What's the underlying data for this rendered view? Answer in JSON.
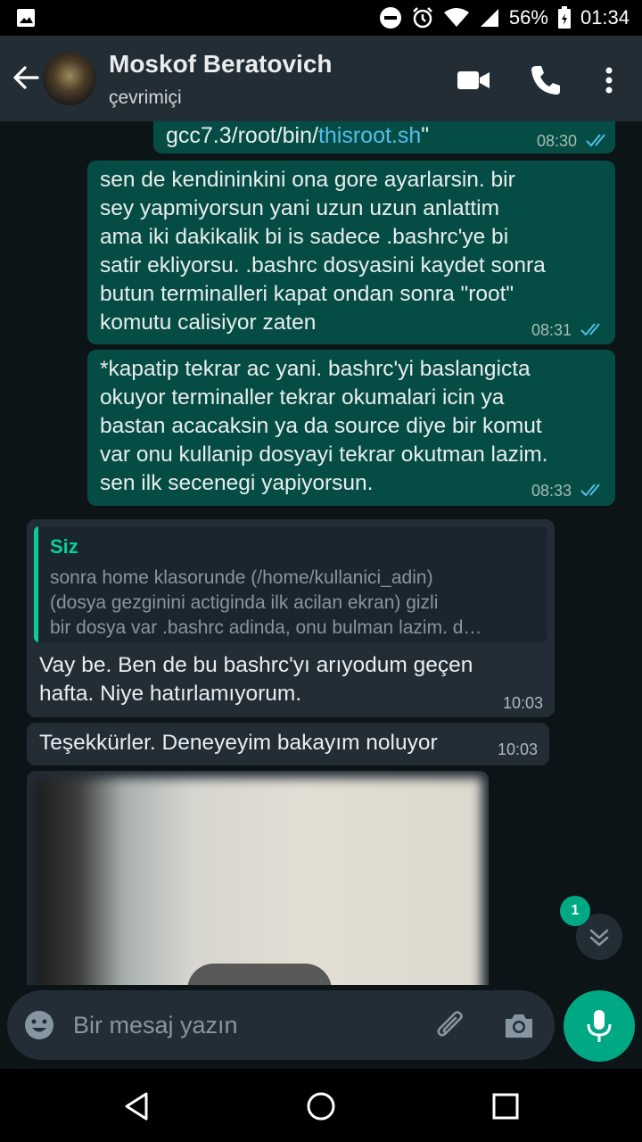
{
  "status_bar": {
    "battery": "56%",
    "time": "01:34"
  },
  "header": {
    "contact_name": "Moskof Beratovich",
    "contact_status": "çevrimiçi"
  },
  "messages": [
    {
      "direction": "out",
      "text_prefix": "gcc7.3/root/bin/",
      "link": "thisroot.sh",
      "text_suffix": "\"",
      "time": "08:30"
    },
    {
      "direction": "out",
      "lines": [
        "sen de kendininkini ona gore ayarlarsin. bir",
        "sey yapmiyorsun yani uzun uzun anlattim",
        "ama iki dakikalik bi is sadece .bashrc'ye bi",
        "satir ekliyorsu. .bashrc dosyasini kaydet sonra",
        "butun terminalleri kapat ondan sonra \"root\"",
        "komutu calisiyor zaten"
      ],
      "time": "08:31"
    },
    {
      "direction": "out",
      "lines": [
        "*kapatip tekrar ac yani. bashrc'yi baslangicta",
        "okuyor terminaller tekrar okumalari icin ya",
        "bastan acacaksin ya da source diye bir komut",
        "var onu kullanip dosyayi tekrar okutman lazim.",
        "sen ilk secenegi yapiyorsun."
      ],
      "time": "08:33"
    },
    {
      "direction": "in",
      "quote": {
        "author": "Siz",
        "lines": [
          "sonra home klasorunde (/home/kullanici_adin)",
          "(dosya gezginini actiginda ilk acilan ekran) gizli",
          "bir dosya var .bashrc adinda, onu bulman lazim. d…"
        ]
      },
      "lines": [
        "Vay be. Ben de bu bashrc'yı arıyodum geçen",
        "hafta. Niye hatırlamıyorum."
      ],
      "time": "10:03"
    },
    {
      "direction": "in",
      "text": "Teşekkürler. Deneyeyim bakayım noluyor",
      "time": "10:03"
    }
  ],
  "unread_count": "1",
  "composer": {
    "placeholder": "Bir mesaj yazın"
  },
  "icons": [
    "image-icon",
    "dnd-icon",
    "alarm-icon",
    "wifi-icon",
    "signal-icon",
    "battery-icon",
    "back-arrow-icon",
    "video-call-icon",
    "phone-icon",
    "more-icon",
    "read-ticks-icon",
    "chevrons-down-icon",
    "emoji-icon",
    "attach-icon",
    "camera-icon",
    "mic-icon",
    "nav-back-icon",
    "nav-home-icon",
    "nav-recents-icon"
  ],
  "colors": {
    "accent": "#00a884",
    "outgoing_bubble": "#054d44",
    "incoming_bubble": "#232d36",
    "background": "#0d1418",
    "tick_blue": "#53bdeb"
  }
}
